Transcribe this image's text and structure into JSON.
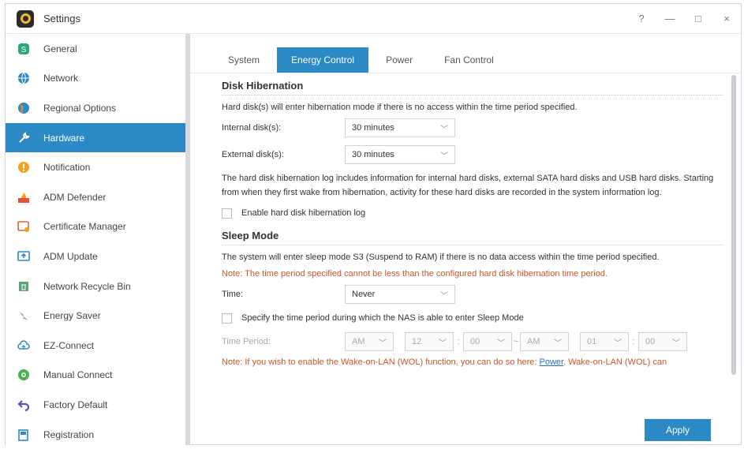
{
  "window": {
    "title": "Settings",
    "help": "?",
    "minimize": "—",
    "maximize": "□",
    "close": "×"
  },
  "sidebar": {
    "items": [
      {
        "label": "General",
        "icon": "general-icon",
        "color": "#2aa876"
      },
      {
        "label": "Network",
        "icon": "globe-icon",
        "color": "#2b8ac6"
      },
      {
        "label": "Regional Options",
        "icon": "regional-icon",
        "color": "#e58a2a"
      },
      {
        "label": "Hardware",
        "icon": "wrench-icon",
        "color": "#ffffff",
        "active": true
      },
      {
        "label": "Notification",
        "icon": "alert-icon",
        "color": "#f0a21d"
      },
      {
        "label": "ADM Defender",
        "icon": "firewall-icon",
        "color": "#e2533a"
      },
      {
        "label": "Certificate Manager",
        "icon": "certificate-icon",
        "color": "#e3602a"
      },
      {
        "label": "ADM Update",
        "icon": "update-icon",
        "color": "#2b8ac6"
      },
      {
        "label": "Network Recycle Bin",
        "icon": "recycle-bin-icon",
        "color": "#5ea07a"
      },
      {
        "label": "Energy Saver",
        "icon": "energy-icon",
        "color": "#3aa655"
      },
      {
        "label": "EZ-Connect",
        "icon": "cloud-icon",
        "color": "#2b8ac6"
      },
      {
        "label": "Manual Connect",
        "icon": "manual-connect-icon",
        "color": "#4caf50"
      },
      {
        "label": "Factory Default",
        "icon": "undo-icon",
        "color": "#6a4bc4"
      },
      {
        "label": "Registration",
        "icon": "registration-icon",
        "color": "#2b8ac6"
      }
    ]
  },
  "tabs": [
    "System",
    "Energy Control",
    "Power",
    "Fan Control"
  ],
  "disk": {
    "title": "Disk Hibernation",
    "desc": "Hard disk(s) will enter hibernation mode if there is no access within the time period specified.",
    "internal_label": "Internal disk(s):",
    "internal_value": "30 minutes",
    "external_label": "External disk(s):",
    "external_value": "30 minutes",
    "log_desc": "The hard disk hibernation log includes information for internal hard disks, external SATA hard disks and USB hard disks. Starting from when they first wake from hibernation, activity for these hard disks are recorded in the system information log.",
    "log_checkbox": "Enable hard disk hibernation log"
  },
  "sleep": {
    "title": "Sleep Mode",
    "desc": "The system will enter sleep mode S3 (Suspend to RAM) if there is no data access within the time period specified.",
    "note": "Note: The time period specified cannot be less than the configured hard disk hibernation time period.",
    "time_label": "Time:",
    "time_value": "Never",
    "specify_checkbox": "Specify the time period during which the NAS is able to enter Sleep Mode",
    "period_label": "Time Period:",
    "from_ampm": "AM",
    "from_hour": "12",
    "from_min": "00",
    "tilde": "~",
    "to_ampm": "AM",
    "to_hour": "01",
    "to_min": "00",
    "wol_note_prefix": "Note: If you wish to enable the Wake-on-LAN (WOL) function, you can do so here: ",
    "wol_link": "Power",
    "wol_note_suffix": ". Wake-on-LAN (WOL) can"
  },
  "apply": "Apply",
  "accent": "#2b8ac6"
}
